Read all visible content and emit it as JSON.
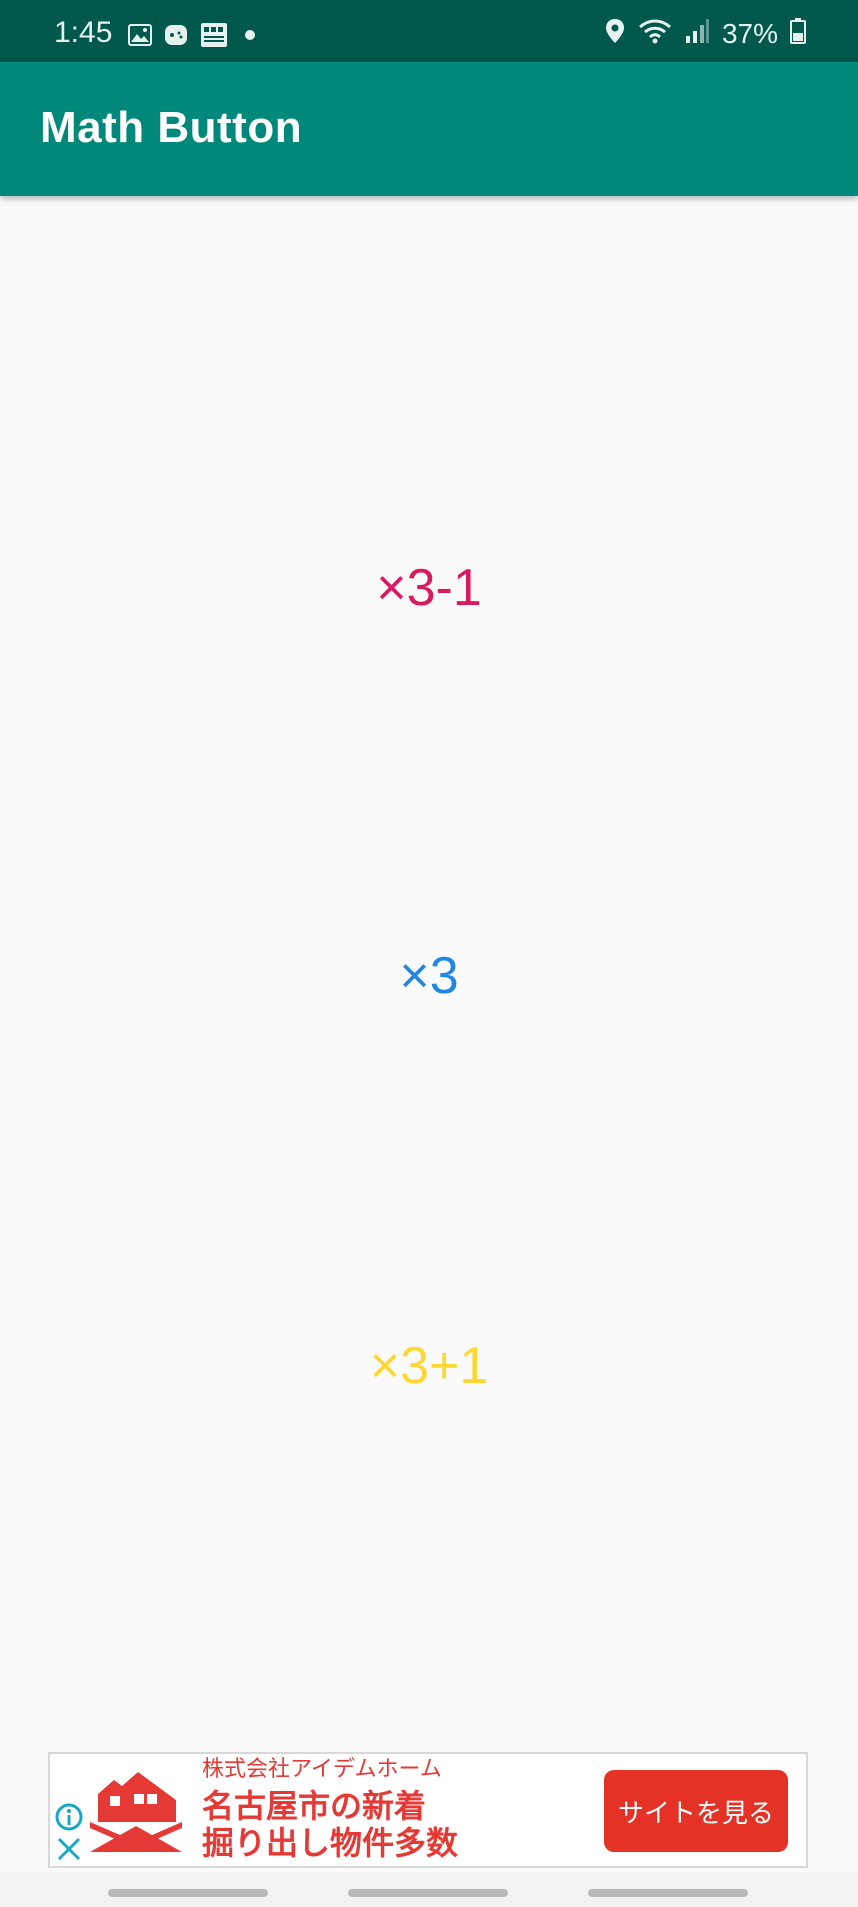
{
  "status_bar": {
    "time": "1:45",
    "battery": "37%",
    "left_icons": [
      "gallery-icon",
      "game-controller-icon",
      "calendar-app-icon",
      "notification-dot-icon"
    ],
    "right_icons": [
      "location-icon",
      "wifi-icon",
      "signal-icon",
      "battery-icon"
    ]
  },
  "app_bar": {
    "title": "Math Button",
    "color": "#00897b"
  },
  "buttons": [
    {
      "label": "×3-1",
      "color": "#d81b60"
    },
    {
      "label": "×3",
      "color": "#1e88e5"
    },
    {
      "label": "×3+1",
      "color": "#fdd835"
    }
  ],
  "ad": {
    "company": "株式会社アイデムホーム",
    "headline_line1": "名古屋市の新着",
    "headline_line2": "掘り出し物件多数",
    "cta": "サイトを見る",
    "accent": "#e53935"
  }
}
